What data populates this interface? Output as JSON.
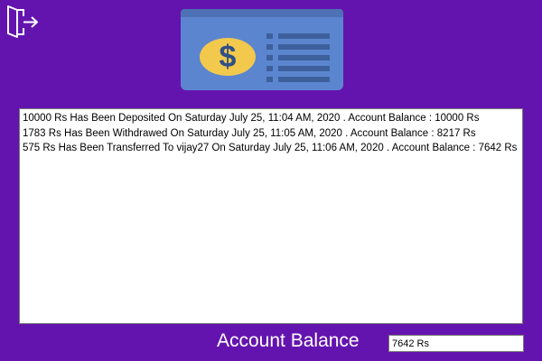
{
  "colors": {
    "window_background": "#6414ae",
    "card_body": "#5b86cf",
    "card_band": "#4d71b4",
    "coin": "#f2c94c",
    "coin_symbol": "#2f4f86",
    "text_white": "#ffffff"
  },
  "toolbar": {
    "exit_icon": "exit-door-icon"
  },
  "header": {
    "illustration_icon": "money-card-icon",
    "currency_symbol": "$"
  },
  "transactions": [
    "10000 Rs Has Been Deposited On Saturday July 25, 11:04 AM, 2020 . Account Balance : 10000 Rs",
    "1783 Rs Has Been Withdrawed On Saturday July 25, 11:05 AM, 2020 . Account Balance : 8217 Rs",
    "575 Rs Has Been Transferred To vijay27 On Saturday July 25, 11:06 AM, 2020 . Account Balance : 7642 Rs"
  ],
  "balance": {
    "label": "Account Balance",
    "value": "7642 Rs"
  }
}
